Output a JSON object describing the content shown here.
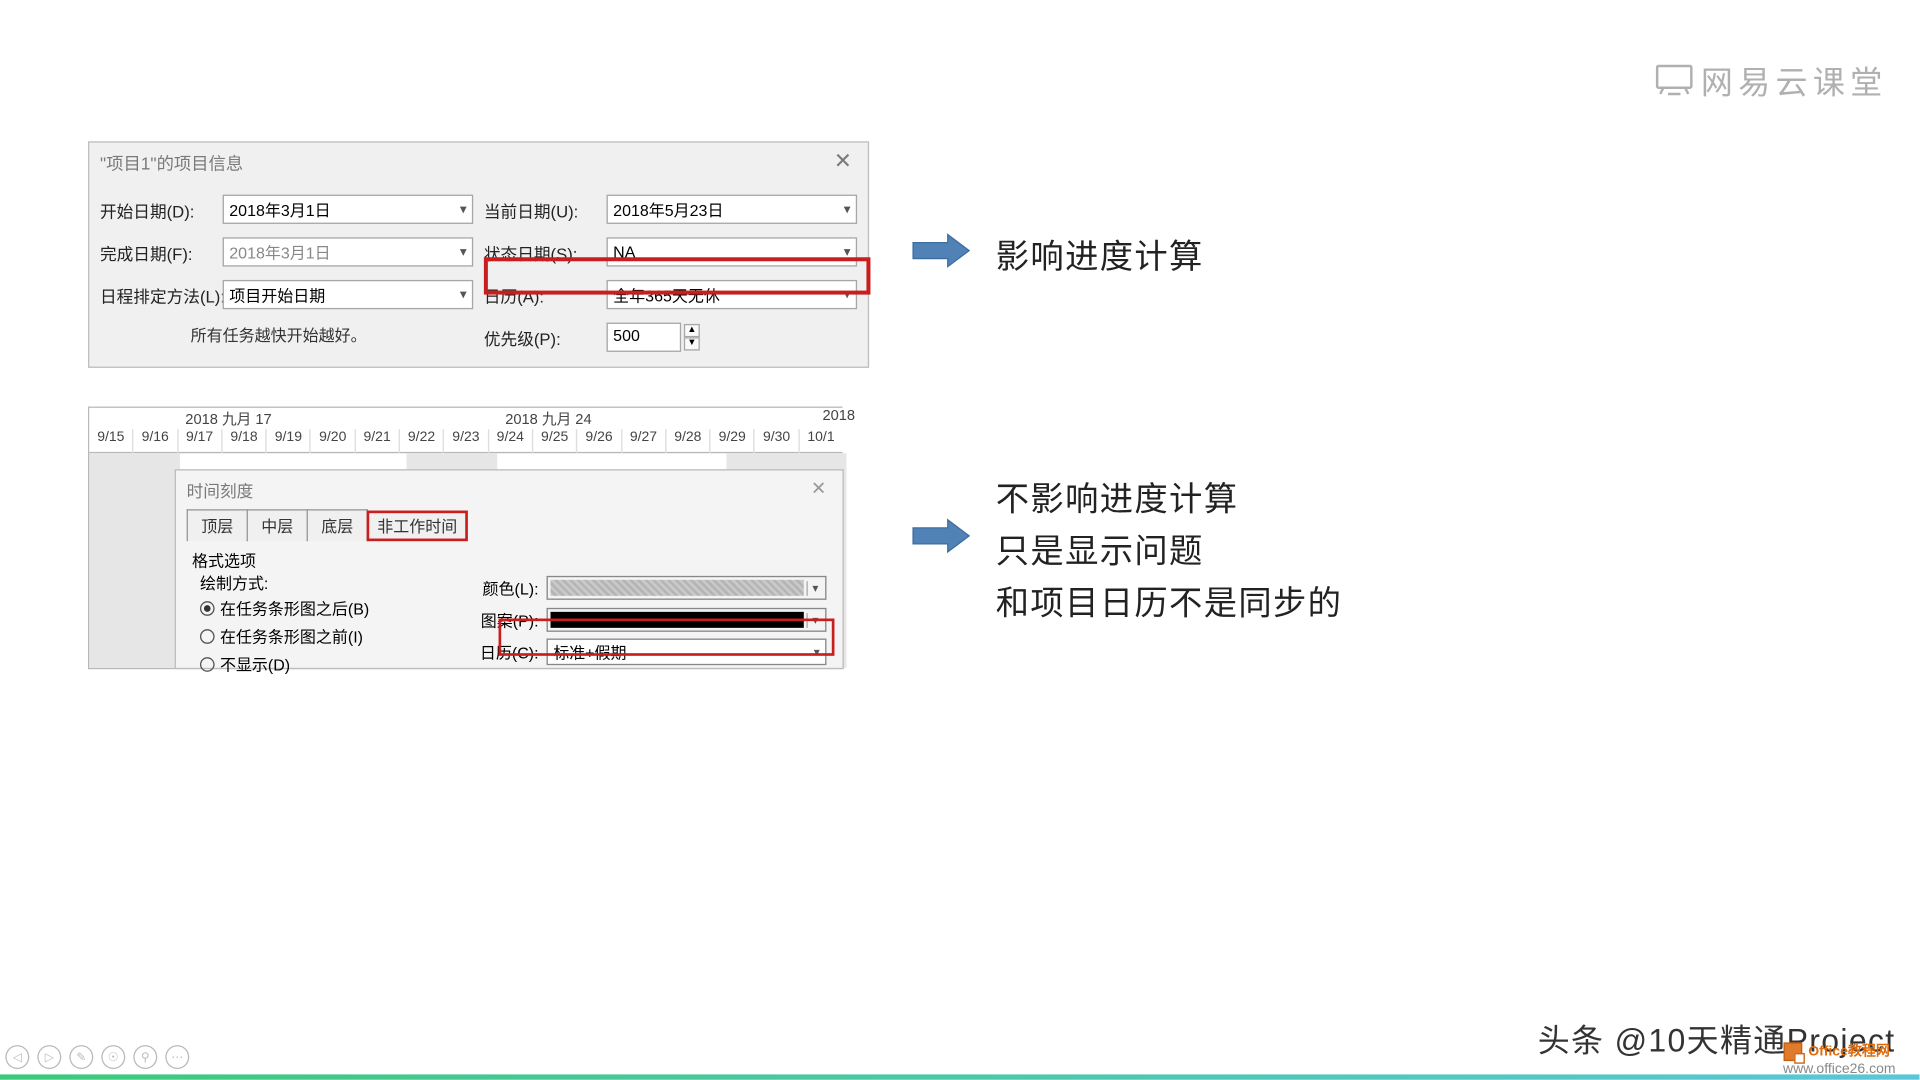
{
  "watermark_top": "网易云课堂",
  "dialog1": {
    "title": "\"项目1\"的项目信息",
    "labels": {
      "start_date": "开始日期(D):",
      "finish_date": "完成日期(F):",
      "schedule_from": "日程排定方法(L):",
      "current_date": "当前日期(U):",
      "status_date": "状态日期(S):",
      "calendar": "日历(A):",
      "priority": "优先级(P):"
    },
    "values": {
      "start_date": "2018年3月1日",
      "finish_date": "2018年3月1日",
      "schedule_from": "项目开始日期",
      "current_date": "2018年5月23日",
      "status_date": "NA",
      "calendar": "全年365天无休",
      "priority": "500"
    },
    "note": "所有任务越快开始越好。"
  },
  "gantt": {
    "week1": "2018 九月 17",
    "week2": "2018 九月 24",
    "week3": "2018",
    "days": [
      "9/15",
      "9/16",
      "9/17",
      "9/18",
      "9/19",
      "9/20",
      "9/21",
      "9/22",
      "9/23",
      "9/24",
      "9/25",
      "9/26",
      "9/27",
      "9/28",
      "9/29",
      "9/30",
      "10/1"
    ]
  },
  "dialog2": {
    "title": "时间刻度",
    "tabs": {
      "top": "顶层",
      "mid": "中层",
      "bot": "底层",
      "nonwork": "非工作时间"
    },
    "section": "格式选项",
    "draw_label": "绘制方式:",
    "radios": {
      "behind": "在任务条形图之后(B)",
      "front": "在任务条形图之前(I)",
      "none": "不显示(D)"
    },
    "color_label": "颜色(L):",
    "pattern_label": "图案(P):",
    "calendar_label": "日历(C):",
    "calendar_value": "标准+假期"
  },
  "annotations": {
    "a1": "影响进度计算",
    "a2_l1": "不影响进度计算",
    "a2_l2": "只是显示问题",
    "a2_l3": "和项目日历不是同步的"
  },
  "footer_headline": "头条 @10天精通Project",
  "footer_logo_text": "ffice教程网",
  "footer_url": "www.office26.com"
}
